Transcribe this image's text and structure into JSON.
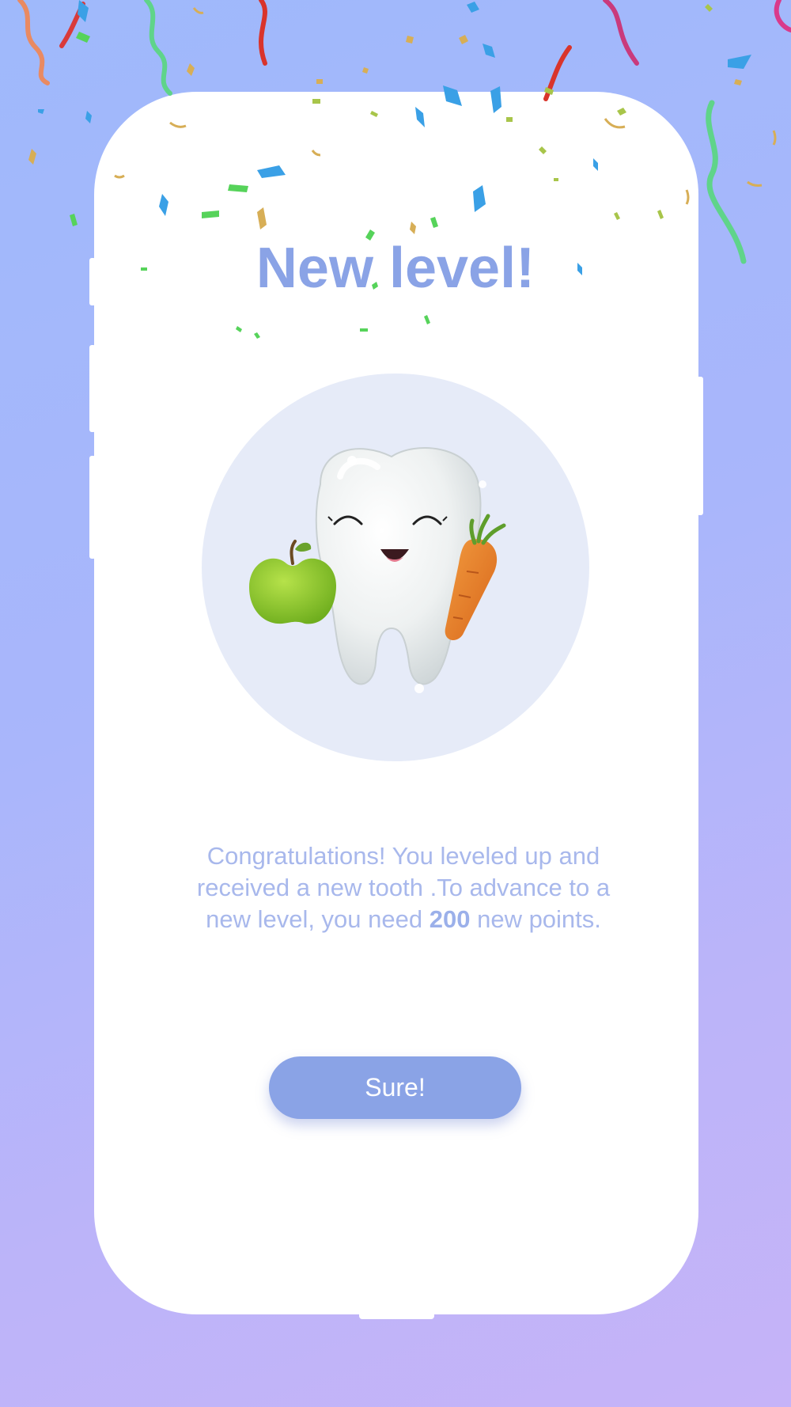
{
  "dialog": {
    "title": "New level!",
    "message_part1": "Congratulations! You leveled up and received a new tooth .To advance to a new level, you need ",
    "points": "200",
    "message_part2": " new points.",
    "button_label": "Sure!"
  },
  "illustration": {
    "icon": "smiling-tooth-with-apple-and-carrot"
  },
  "colors": {
    "background_top": "#9fb9fb",
    "background_bottom": "#c6b3f8",
    "card": "#ffffff",
    "accent": "#8aa3e6",
    "message_text": "#a8b8ec",
    "illustration_circle": "#e6ebf8"
  }
}
